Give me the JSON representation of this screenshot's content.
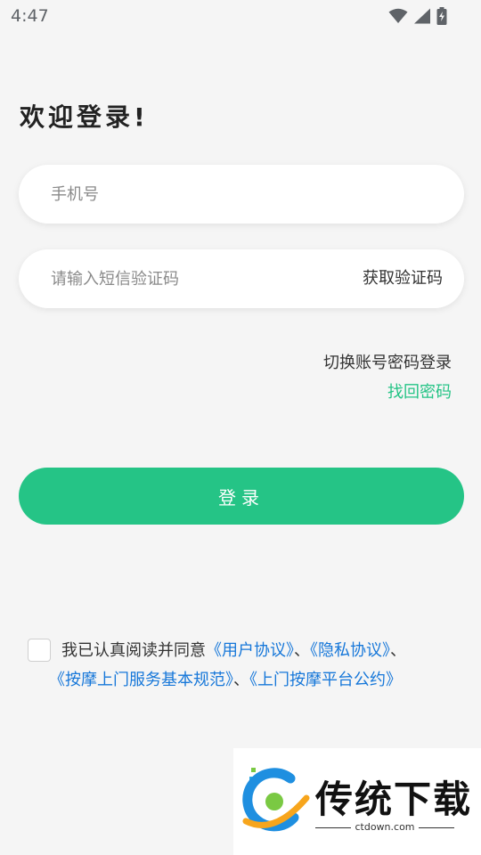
{
  "status_bar": {
    "time": "4:47"
  },
  "welcome": "欢迎登录!",
  "phone": {
    "placeholder": "手机号",
    "value": ""
  },
  "code": {
    "placeholder": "请输入短信验证码",
    "value": "",
    "get_code": "获取验证码"
  },
  "switch_login": "切换账号密码登录",
  "forgot_password": "找回密码",
  "login_button": "登录",
  "agreement": {
    "prefix": "我已认真阅读并同意",
    "user_agreement": "《用户协议》",
    "sep1": "、",
    "privacy": "《隐私协议》",
    "sep2": "、",
    "massage_norms": "《按摩上门服务基本规范》",
    "sep3": "、",
    "platform_convention": "《上门按摩平台公约》"
  },
  "watermark": {
    "title": "传统下载",
    "url": "ctdown.com"
  },
  "colors": {
    "accent": "#25c486",
    "link": "#1677d9",
    "background": "#f5f5f5"
  }
}
